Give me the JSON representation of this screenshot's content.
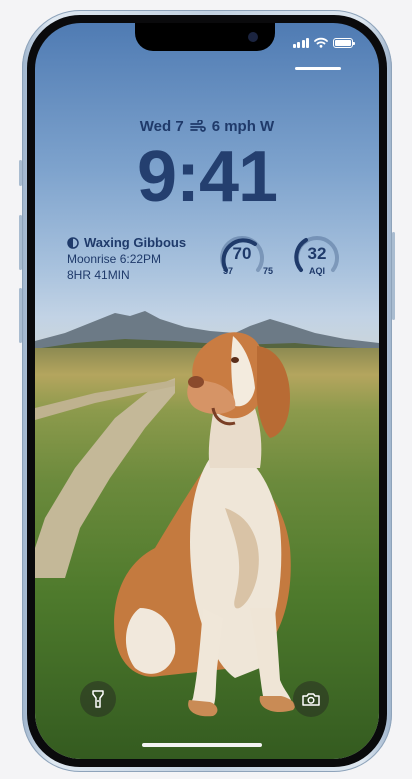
{
  "lock_screen": {
    "date": "Wed 7",
    "weather": "6 mph W",
    "time": "9:41",
    "moon": {
      "phase": "Waxing Gibbous",
      "moonrise": "Moonrise 6:22PM",
      "duration": "8HR 41MIN"
    },
    "temperature": {
      "value": "70",
      "low": "57",
      "high": "75"
    },
    "aqi": {
      "value": "32",
      "label": "AQI"
    }
  },
  "icons": {
    "wind": "wind-icon",
    "moon": "half-moon-icon",
    "flashlight": "flashlight-icon",
    "camera": "camera-icon",
    "signal": "signal-icon",
    "wifi": "wifi-icon",
    "battery": "battery-icon"
  },
  "colors": {
    "widget_text": "#1f3a6a",
    "clock": "#243f6f"
  }
}
